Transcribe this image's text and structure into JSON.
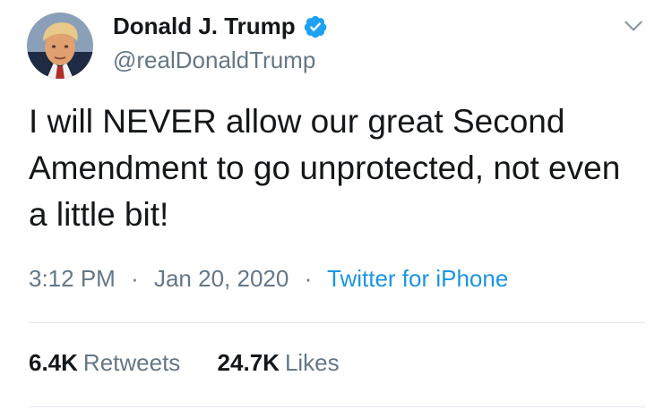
{
  "user": {
    "display_name": "Donald J. Trump",
    "handle": "@realDonaldTrump",
    "verified_icon": "verified-badge-icon"
  },
  "tweet": {
    "text": "I will NEVER allow our great Second Amendment to go unprotected, not even a little bit!",
    "time": "3:12 PM",
    "date": "Jan 20, 2020",
    "separator": "·",
    "source": "Twitter for iPhone"
  },
  "stats": {
    "retweets_count": "6.4K",
    "retweets_label": "Retweets",
    "likes_count": "24.7K",
    "likes_label": "Likes"
  },
  "colors": {
    "text_primary": "#14171a",
    "text_secondary": "#657786",
    "link": "#1b95e0",
    "verified": "#1da1f2",
    "divider": "#e1e8ed"
  },
  "icons": {
    "more": "chevron-down-icon",
    "verified": "verified-badge-icon"
  }
}
